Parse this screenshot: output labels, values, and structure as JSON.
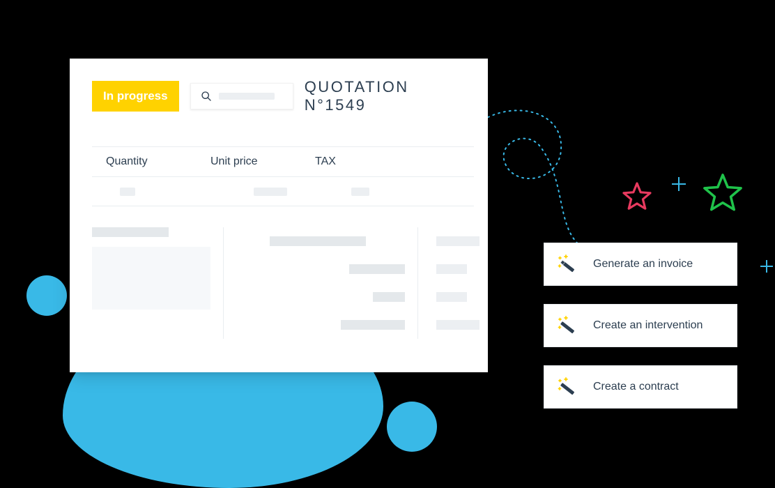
{
  "status_label": "In progress",
  "quotation_title": "QUOTATION  N°1549",
  "table": {
    "headers": {
      "qty": "Quantity",
      "price": "Unit price",
      "tax": "TAX"
    }
  },
  "actions": {
    "invoice": "Generate an invoice",
    "intervention": "Create an intervention",
    "contract": "Create a contract"
  },
  "colors": {
    "accent": "#39b9e7",
    "status_bg": "#ffd200",
    "star_red": "#e83a5f",
    "star_green": "#1fc24a",
    "wand_sparkle": "#ffd200"
  }
}
